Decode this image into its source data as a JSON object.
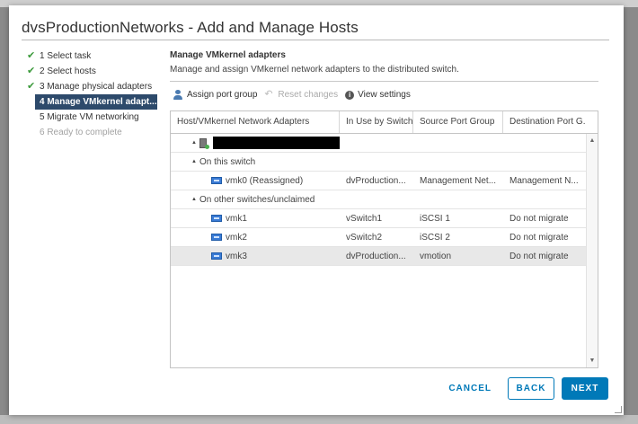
{
  "dialog": {
    "title": "dvsProductionNetworks - Add and Manage Hosts"
  },
  "steps": [
    {
      "label": "1 Select task",
      "state": "done"
    },
    {
      "label": "2 Select hosts",
      "state": "done"
    },
    {
      "label": "3 Manage physical adapters",
      "state": "done"
    },
    {
      "label": "4 Manage VMkernel adapt...",
      "state": "active"
    },
    {
      "label": "5 Migrate VM networking",
      "state": "pending"
    },
    {
      "label": "6 Ready to complete",
      "state": "disabled"
    }
  ],
  "content": {
    "title": "Manage VMkernel adapters",
    "description": "Manage and assign VMkernel network adapters to the distributed switch."
  },
  "toolbar": {
    "assign_port_group": "Assign port group",
    "reset_changes": "Reset changes",
    "view_settings": "View settings"
  },
  "grid": {
    "columns": [
      "Host/VMkernel Network Adapters",
      "In Use by Switch",
      "Source Port Group",
      "Destination Port G..."
    ],
    "groups": {
      "on_this_switch": "On this switch",
      "other": "On other switches/unclaimed"
    },
    "rows": [
      {
        "name": "vmk0 (Reassigned)",
        "switch": "dvProduction...",
        "source": "Management Net...",
        "dest": "Management N...",
        "group": "on_this_switch"
      },
      {
        "name": "vmk1",
        "switch": "vSwitch1",
        "source": "iSCSI 1",
        "dest": "Do not migrate",
        "group": "other"
      },
      {
        "name": "vmk2",
        "switch": "vSwitch2",
        "source": "iSCSI 2",
        "dest": "Do not migrate",
        "group": "other"
      },
      {
        "name": "vmk3",
        "switch": "dvProduction...",
        "source": "vmotion",
        "dest": "Do not migrate",
        "group": "other",
        "selected": true
      }
    ]
  },
  "footer": {
    "cancel": "CANCEL",
    "back": "BACK",
    "next": "NEXT"
  },
  "colors": {
    "accent": "#0079b8",
    "active_step": "#2d4a6b",
    "check": "#3c9a3c"
  }
}
